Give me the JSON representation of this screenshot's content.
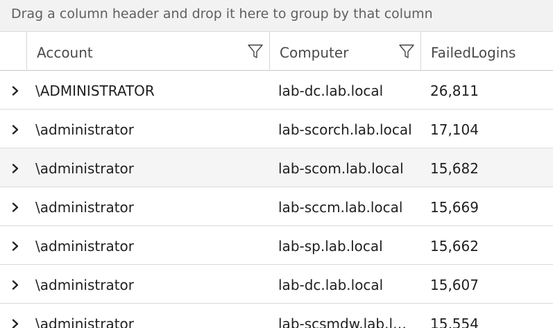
{
  "group_bar": {
    "text": "Drag a column header and drop it here to group by that column"
  },
  "columns": {
    "account": "Account",
    "computer": "Computer",
    "failed": "FailedLogins"
  },
  "rows": [
    {
      "account": "\\ADMINISTRATOR",
      "computer": "lab-dc.lab.local",
      "failed": "26,811"
    },
    {
      "account": "\\administrator",
      "computer": "lab-scorch.lab.local",
      "failed": "17,104"
    },
    {
      "account": "\\administrator",
      "computer": "lab-scom.lab.local",
      "failed": "15,682"
    },
    {
      "account": "\\administrator",
      "computer": "lab-sccm.lab.local",
      "failed": "15,669"
    },
    {
      "account": "\\administrator",
      "computer": "lab-sp.lab.local",
      "failed": "15,662"
    },
    {
      "account": "\\administrator",
      "computer": "lab-dc.lab.local",
      "failed": "15,607"
    },
    {
      "account": "\\administrator",
      "computer": "lab-scsmdw.lab.local",
      "failed": "15,554"
    }
  ],
  "icons": {
    "filter": "filter-icon",
    "expand": "chevron-right-icon"
  },
  "colors": {
    "group_bar_bg": "#f2f2f2",
    "hover_row_bg": "#f5f5f5",
    "grid_line": "#dadada"
  }
}
